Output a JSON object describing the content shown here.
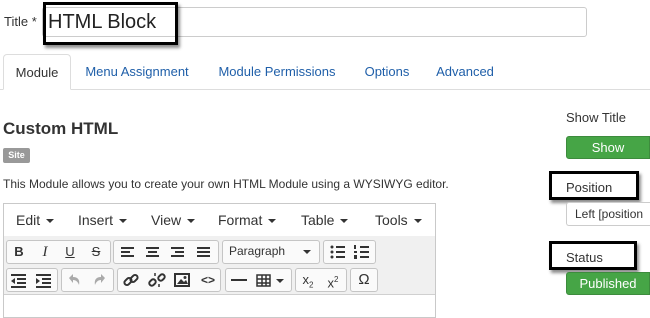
{
  "title_field": {
    "label": "Title *",
    "value": "HTML Block"
  },
  "tabs": [
    {
      "label": "Module",
      "active": true
    },
    {
      "label": "Menu Assignment",
      "active": false
    },
    {
      "label": "Module Permissions",
      "active": false
    },
    {
      "label": "Options",
      "active": false
    },
    {
      "label": "Advanced",
      "active": false
    }
  ],
  "module": {
    "heading": "Custom HTML",
    "badge": "Site",
    "description": "This Module allows you to create your own HTML Module using a WYSIWYG editor."
  },
  "editor": {
    "menus": [
      "Edit",
      "Insert",
      "View",
      "Format",
      "Table",
      "Tools"
    ],
    "format_select": "Paragraph",
    "icons_row1": [
      "bold-icon",
      "italic-icon",
      "underline-icon",
      "strikethrough-icon",
      "align-left-icon",
      "align-center-icon",
      "align-right-icon",
      "align-justify-icon",
      "format-dropdown",
      "bullet-list-icon",
      "numbered-list-icon"
    ],
    "icons_row2": [
      "outdent-icon",
      "indent-icon",
      "undo-icon",
      "redo-icon",
      "link-icon",
      "unlink-icon",
      "image-icon",
      "code-icon",
      "horizontal-rule-icon",
      "table-icon",
      "subscript-icon",
      "superscript-icon",
      "special-char-icon"
    ],
    "glyphs": {
      "bold": "B",
      "italic": "I",
      "underline": "U",
      "strike": "S",
      "code": "<>",
      "subscript": "x",
      "superscript": "x",
      "subscript_mark": "2",
      "superscript_mark": "2",
      "omega": "Ω"
    }
  },
  "sidebar": {
    "show_title": {
      "label": "Show Title",
      "button": "Show"
    },
    "position": {
      "label": "Position",
      "value": "Left [position"
    },
    "status": {
      "label": "Status",
      "button": "Published"
    }
  },
  "colors": {
    "link": "#1f5fa9",
    "published_green": "#46a546",
    "badge_gray": "#999999"
  }
}
